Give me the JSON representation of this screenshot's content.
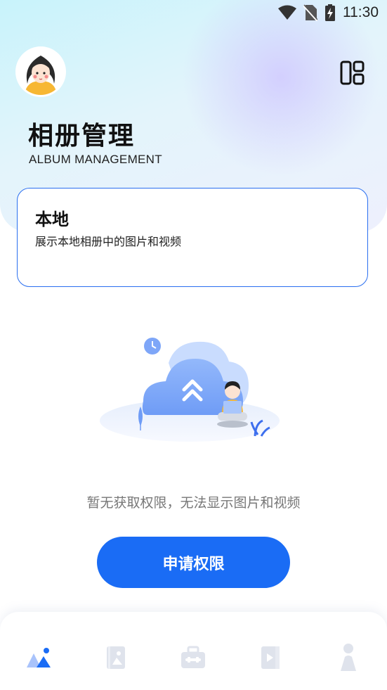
{
  "status_bar": {
    "time": "11:30",
    "icons": [
      "wifi-icon",
      "no-sim-icon",
      "battery-charging-icon"
    ]
  },
  "header": {
    "avatar_icon": "avatar-girl",
    "layout_icon": "layout-grid-icon",
    "title": "相册管理",
    "subtitle": "ALBUM MANAGEMENT"
  },
  "local_card": {
    "title": "本地",
    "description": "展示本地相册中的图片和视频"
  },
  "empty_state": {
    "illustration": "cloud-upload-illustration",
    "message": "暂无获取权限，无法显示图片和视频"
  },
  "request_button": {
    "label": "申请权限"
  },
  "bottom_nav": {
    "items": [
      {
        "icon": "album-icon",
        "active": true
      },
      {
        "icon": "photo-frame-icon",
        "active": false
      },
      {
        "icon": "toolbox-icon",
        "active": false
      },
      {
        "icon": "video-icon",
        "active": false
      },
      {
        "icon": "profile-icon",
        "active": false
      }
    ]
  },
  "colors": {
    "accent": "#1a6cf5",
    "inactive_nav": "#dfe3ec",
    "card_border": "#2a6ff0"
  }
}
